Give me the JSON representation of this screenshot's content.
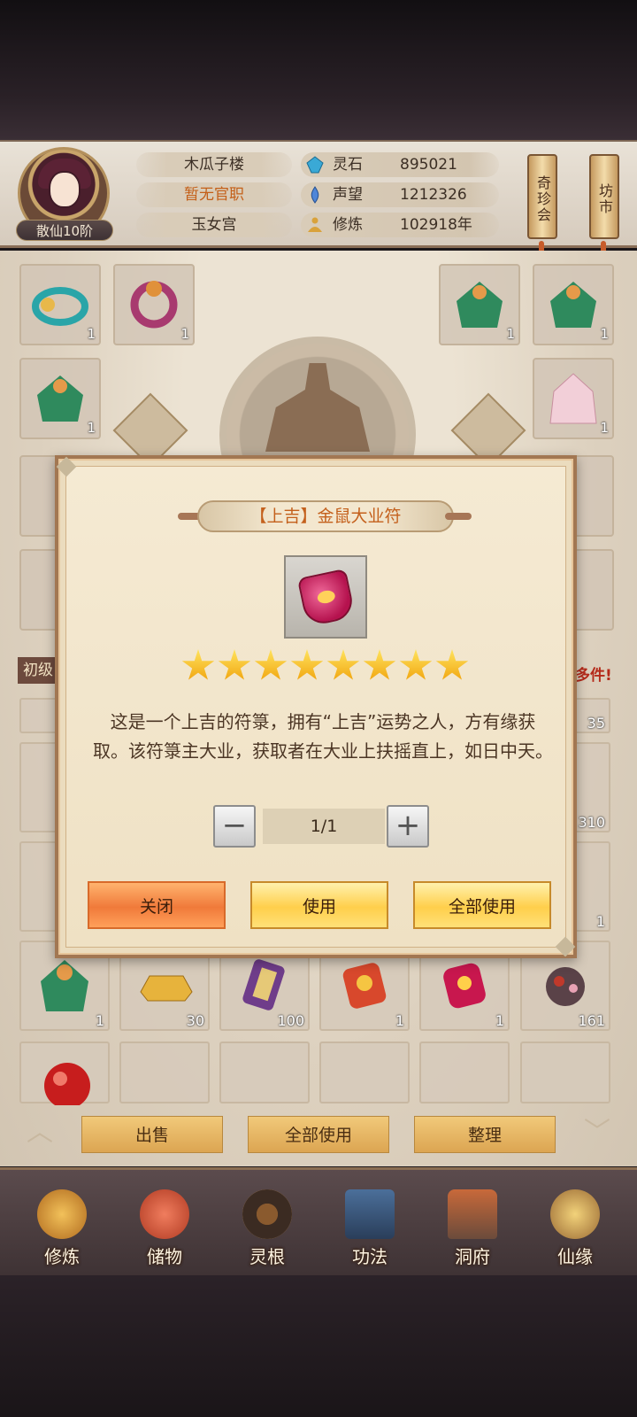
{
  "header": {
    "rank": "散仙10阶",
    "name": "木瓜子楼",
    "official": "暂无官职",
    "sect": "玉女宫",
    "stats": [
      {
        "icon": "spirit-stone-icon",
        "label": "灵石",
        "value": "895021"
      },
      {
        "icon": "prestige-icon",
        "label": "声望",
        "value": "1212326"
      },
      {
        "icon": "cultivation-icon",
        "label": "修炼",
        "value": "102918年"
      }
    ],
    "treasure_fair": "奇珍会",
    "market": "坊市"
  },
  "equipment_counts": [
    "1",
    "1",
    "1",
    "1",
    "1",
    "1"
  ],
  "bag": {
    "left_banner": "初级",
    "right_banner": "多件!",
    "visible_counts": [
      "35",
      "310",
      "1",
      "1",
      "30",
      "100",
      "1",
      "1",
      "161"
    ]
  },
  "actions": {
    "sell": "出售",
    "use_all": "全部使用",
    "arrange": "整理"
  },
  "nav": [
    {
      "label": "修炼",
      "icon": "cultivate-icon"
    },
    {
      "label": "储物",
      "icon": "storage-bag-icon"
    },
    {
      "label": "灵根",
      "icon": "spirit-root-icon"
    },
    {
      "label": "功法",
      "icon": "technique-book-icon"
    },
    {
      "label": "洞府",
      "icon": "cave-mansion-icon"
    },
    {
      "label": "仙缘",
      "icon": "immortal-fate-icon"
    }
  ],
  "modal": {
    "title": "【上吉】金鼠大业符",
    "stars": 8,
    "description": "这是一个上吉的符箓，拥有“上吉”运势之人，方有缘获取。该符箓主大业，获取者在大业上扶摇直上，如日中天。",
    "quantity": "1/1",
    "minus": "−",
    "plus": "+",
    "close": "关闭",
    "use": "使用",
    "use_all": "全部使用"
  },
  "colors": {
    "accent_orange": "#c4601c",
    "modal_bg": "#f5ead3",
    "star": "#f7c21c"
  }
}
